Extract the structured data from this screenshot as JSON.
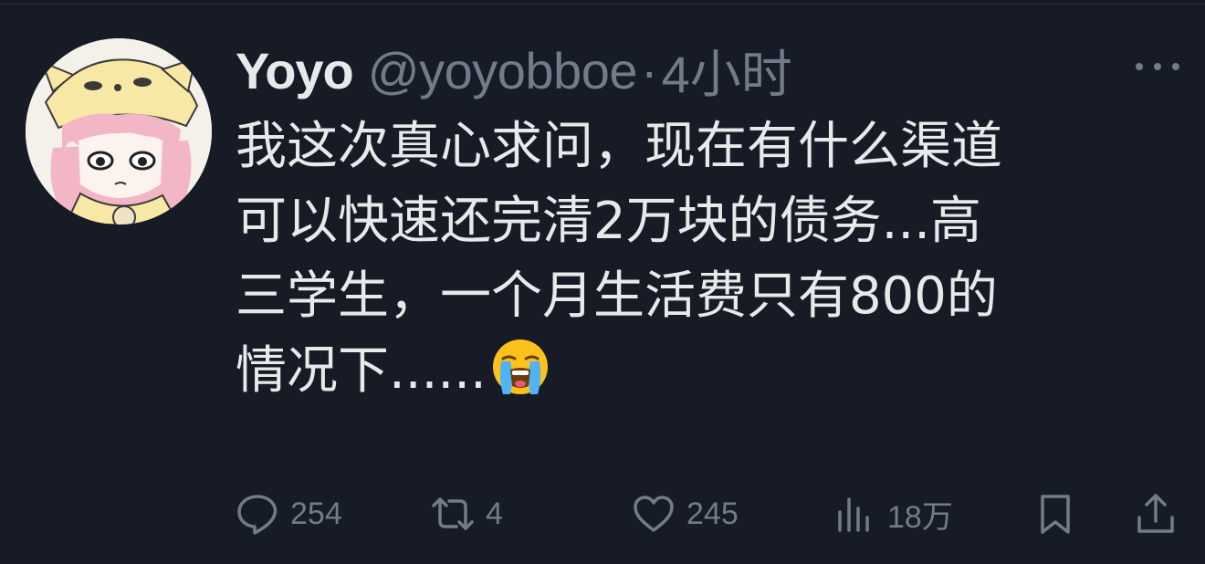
{
  "tweet": {
    "author": {
      "name": "Yoyo",
      "handle": "@yoyobboe",
      "separator": "·",
      "time": "4小时"
    },
    "text_lines": [
      "我这次真心求问，现在有什么渠道",
      "可以快速还完清2万块的债务...高",
      "三学生，一个月生活费只有800的",
      "情况下......"
    ],
    "emoji": "loudly-crying-face",
    "actions": {
      "replies": "254",
      "retweets": "4",
      "likes": "245",
      "views": "18万"
    }
  },
  "colors": {
    "background": "#161b26",
    "text": "#e7e9ea",
    "muted": "#727c88"
  }
}
